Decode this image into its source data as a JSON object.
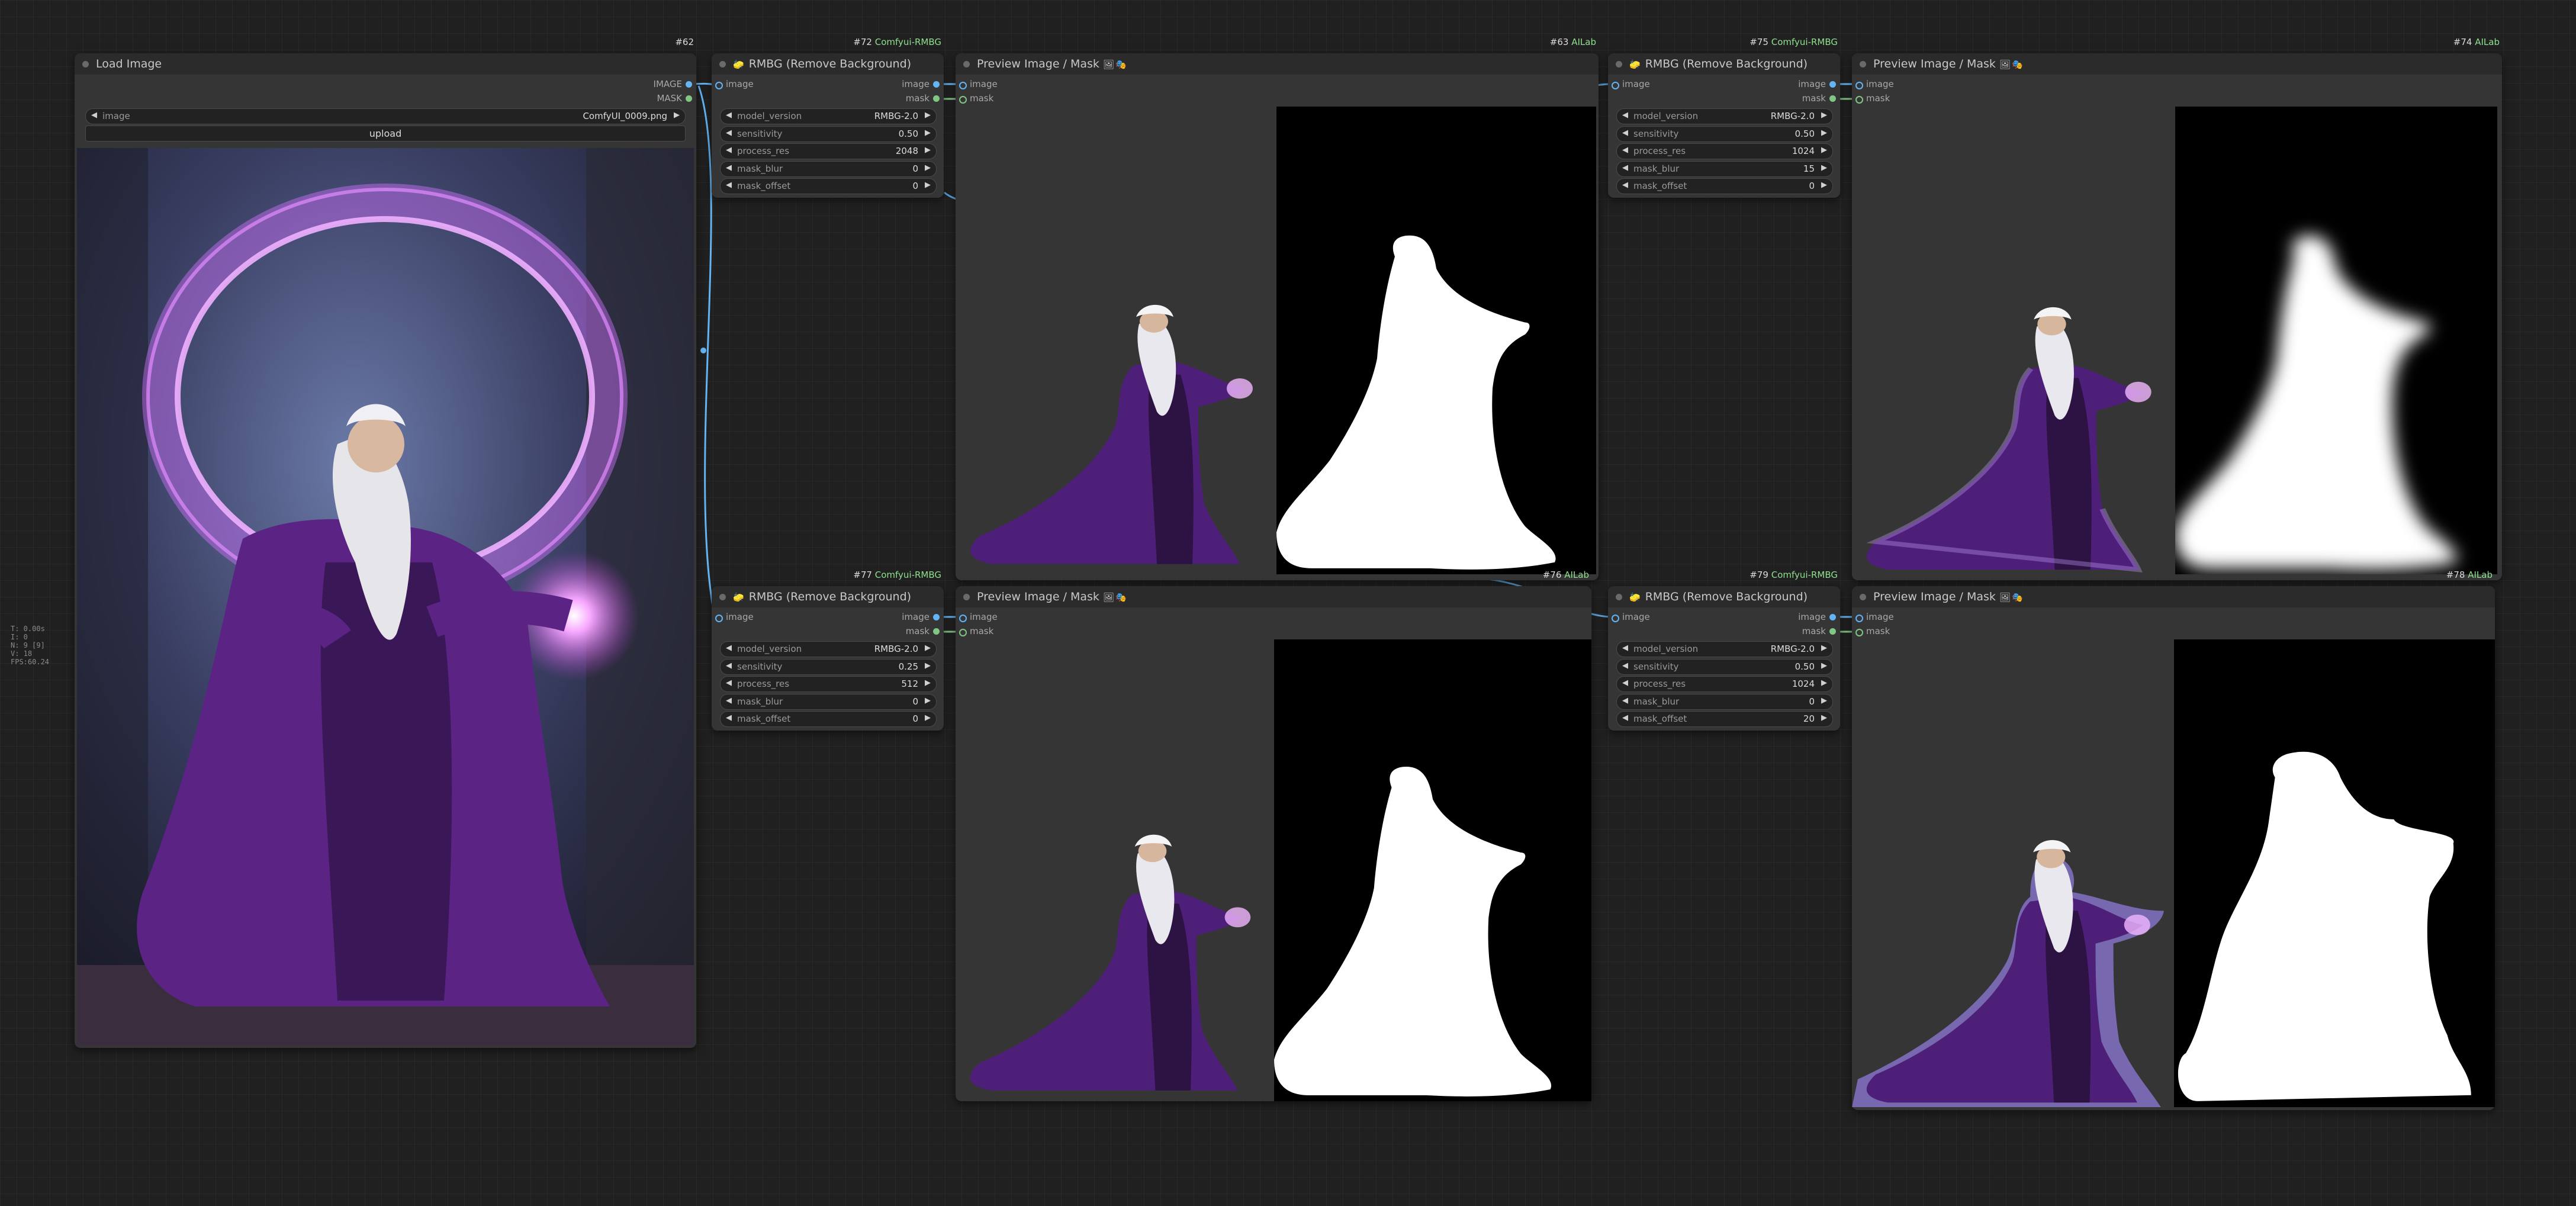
{
  "stats": [
    "T: 0.00s",
    "I: 0",
    "N: 9 [9]",
    "V: 18",
    "FPS:60.24"
  ],
  "load_node": {
    "badge": "#62",
    "title": "Load Image",
    "outputs": [
      "IMAGE",
      "MASK"
    ],
    "image_widget": {
      "label": "image",
      "value": "ComfyUI_0009.png"
    },
    "upload_label": "upload"
  },
  "rmbg_nodes": [
    {
      "id": "72",
      "badge_prefix": "#72",
      "badge_name": "Comfyui-RMBG",
      "title": "RMBG (Remove Background)",
      "input": "image",
      "outputs": [
        "image",
        "mask"
      ],
      "widgets": [
        [
          "model_version",
          "RMBG-2.0"
        ],
        [
          "sensitivity",
          "0.50"
        ],
        [
          "process_res",
          "2048"
        ],
        [
          "mask_blur",
          "0"
        ],
        [
          "mask_offset",
          "0"
        ]
      ]
    },
    {
      "id": "75",
      "badge_prefix": "#75",
      "badge_name": "Comfyui-RMBG",
      "title": "RMBG (Remove Background)",
      "input": "image",
      "outputs": [
        "image",
        "mask"
      ],
      "widgets": [
        [
          "model_version",
          "RMBG-2.0"
        ],
        [
          "sensitivity",
          "0.50"
        ],
        [
          "process_res",
          "1024"
        ],
        [
          "mask_blur",
          "15"
        ],
        [
          "mask_offset",
          "0"
        ]
      ]
    },
    {
      "id": "77",
      "badge_prefix": "#77",
      "badge_name": "Comfyui-RMBG",
      "title": "RMBG (Remove Background)",
      "input": "image",
      "outputs": [
        "image",
        "mask"
      ],
      "widgets": [
        [
          "model_version",
          "RMBG-2.0"
        ],
        [
          "sensitivity",
          "0.25"
        ],
        [
          "process_res",
          "512"
        ],
        [
          "mask_blur",
          "0"
        ],
        [
          "mask_offset",
          "0"
        ]
      ]
    },
    {
      "id": "79",
      "badge_prefix": "#79",
      "badge_name": "Comfyui-RMBG",
      "title": "RMBG (Remove Background)",
      "input": "image",
      "outputs": [
        "image",
        "mask"
      ],
      "widgets": [
        [
          "model_version",
          "RMBG-2.0"
        ],
        [
          "sensitivity",
          "0.50"
        ],
        [
          "process_res",
          "1024"
        ],
        [
          "mask_blur",
          "0"
        ],
        [
          "mask_offset",
          "20"
        ]
      ]
    }
  ],
  "preview_nodes": [
    {
      "id": "63",
      "badge_prefix": "#63",
      "badge_name": "AILab",
      "title": "Preview Image / Mask",
      "inputs": [
        "image",
        "mask"
      ]
    },
    {
      "id": "74",
      "badge_prefix": "#74",
      "badge_name": "AILab",
      "title": "Preview Image / Mask",
      "inputs": [
        "image",
        "mask"
      ]
    },
    {
      "id": "76",
      "badge_prefix": "#76",
      "badge_name": "AILab",
      "title": "Preview Image / Mask",
      "inputs": [
        "image",
        "mask"
      ]
    },
    {
      "id": "78",
      "badge_prefix": "#78",
      "badge_name": "AILab",
      "title": "Preview Image / Mask",
      "inputs": [
        "image",
        "mask"
      ]
    }
  ],
  "colors": {
    "image_link": "#64b5f6",
    "mask_link": "#81c784",
    "node_bg": "#353535",
    "canvas_bg": "#202020"
  }
}
